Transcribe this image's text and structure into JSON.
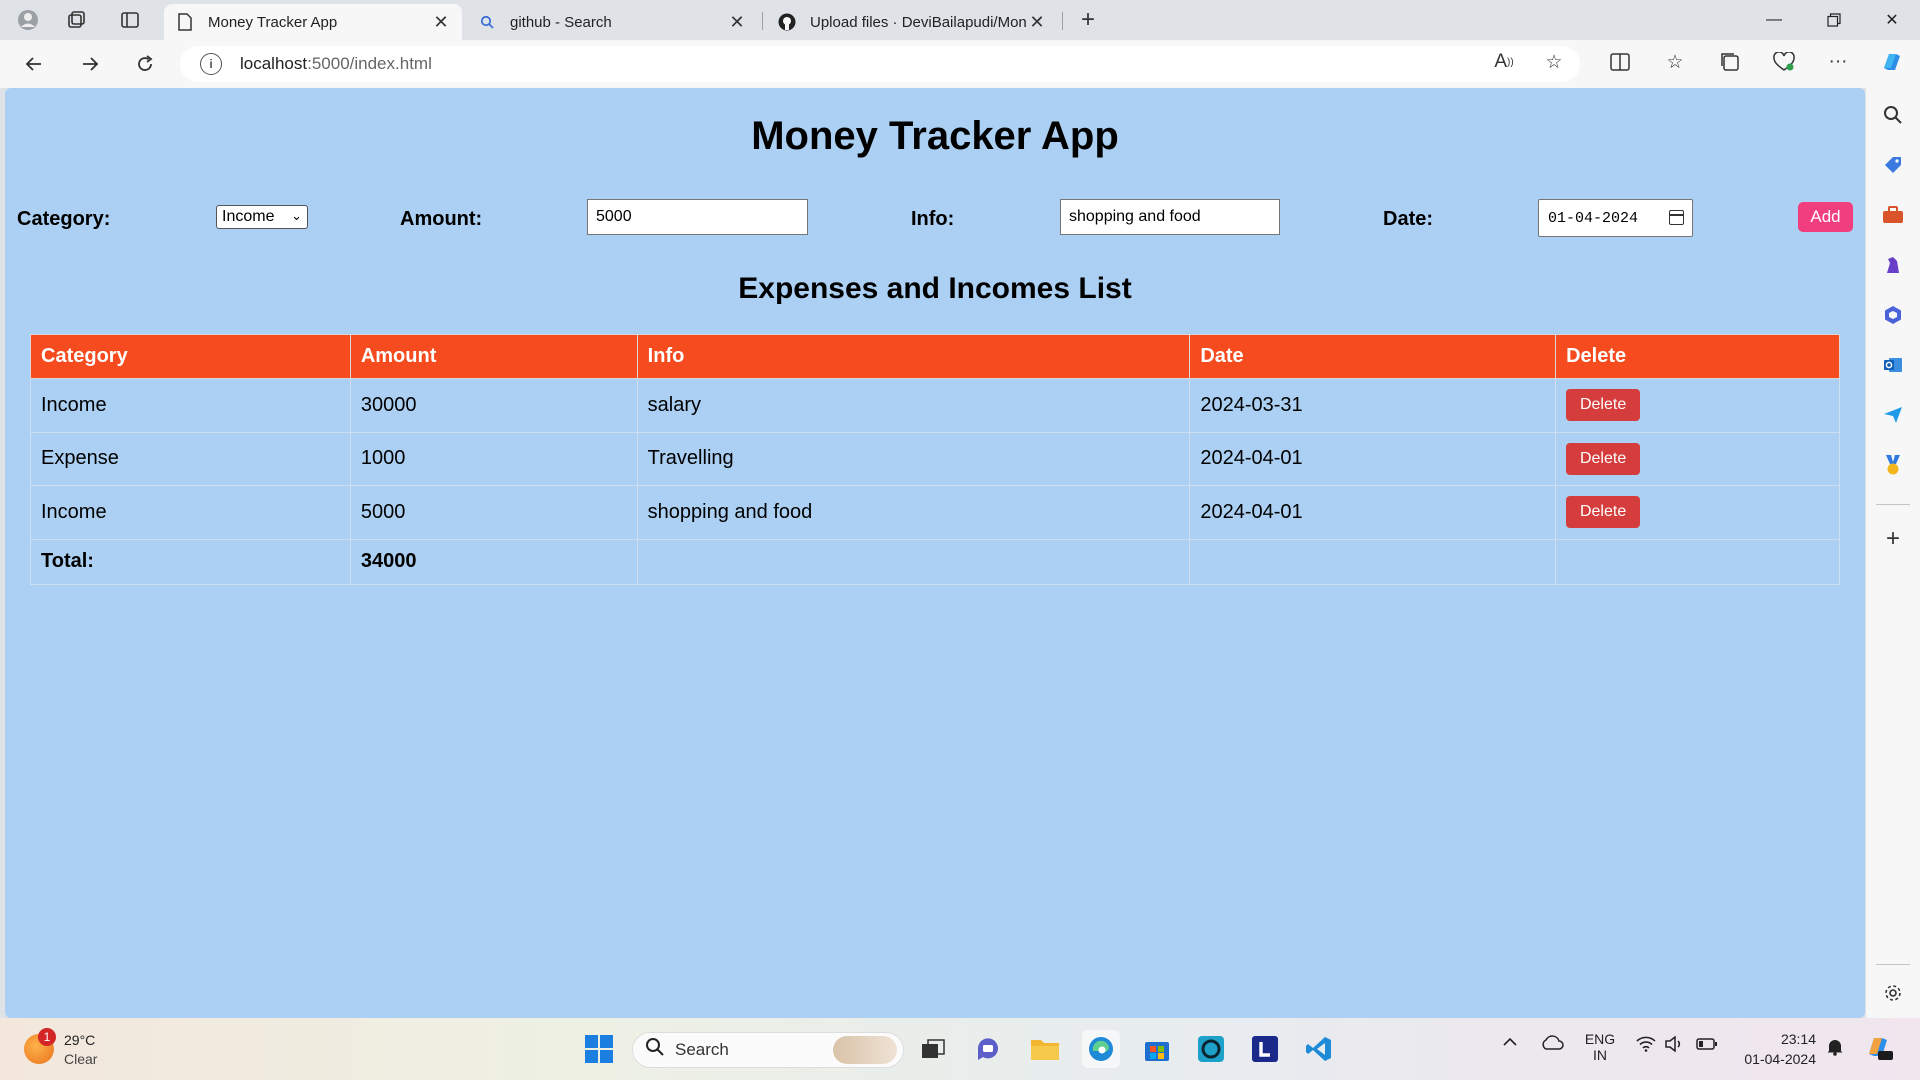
{
  "browser": {
    "tabs": [
      {
        "title": "Money Tracker App",
        "active": true
      },
      {
        "title": "github - Search",
        "active": false
      },
      {
        "title": "Upload files · DeviBailapudi/Mon",
        "active": false
      }
    ],
    "url_host": "localhost",
    "url_rest": ":5000/index.html"
  },
  "app": {
    "title": "Money Tracker App",
    "form": {
      "category_label": "Category:",
      "category_value": "Income",
      "amount_label": "Amount:",
      "amount_value": "5000",
      "info_label": "Info:",
      "info_value": "shopping and food",
      "date_label": "Date:",
      "date_value": "01-04-2024",
      "add_label": "Add"
    },
    "list_title": "Expenses and Incomes List",
    "table": {
      "headers": [
        "Category",
        "Amount",
        "Info",
        "Date",
        "Delete"
      ],
      "rows": [
        {
          "category": "Income",
          "amount": "30000",
          "info": "salary",
          "date": "2024-03-31",
          "delete": "Delete"
        },
        {
          "category": "Expense",
          "amount": "1000",
          "info": "Travelling",
          "date": "2024-04-01",
          "delete": "Delete"
        },
        {
          "category": "Income",
          "amount": "5000",
          "info": "shopping and food",
          "date": "2024-04-01",
          "delete": "Delete"
        }
      ],
      "total_label": "Total:",
      "total_value": "34000"
    }
  },
  "taskbar": {
    "weather_temp": "29°C",
    "weather_desc": "Clear",
    "weather_badge": "1",
    "search_label": "Search",
    "lang_top": "ENG",
    "lang_bottom": "IN",
    "time": "23:14",
    "date": "01-04-2024"
  },
  "colors": {
    "page_bg": "#abd0f3",
    "table_header": "#f54b1e",
    "delete_button": "#d53c3c",
    "add_button": "#f13e7f"
  }
}
